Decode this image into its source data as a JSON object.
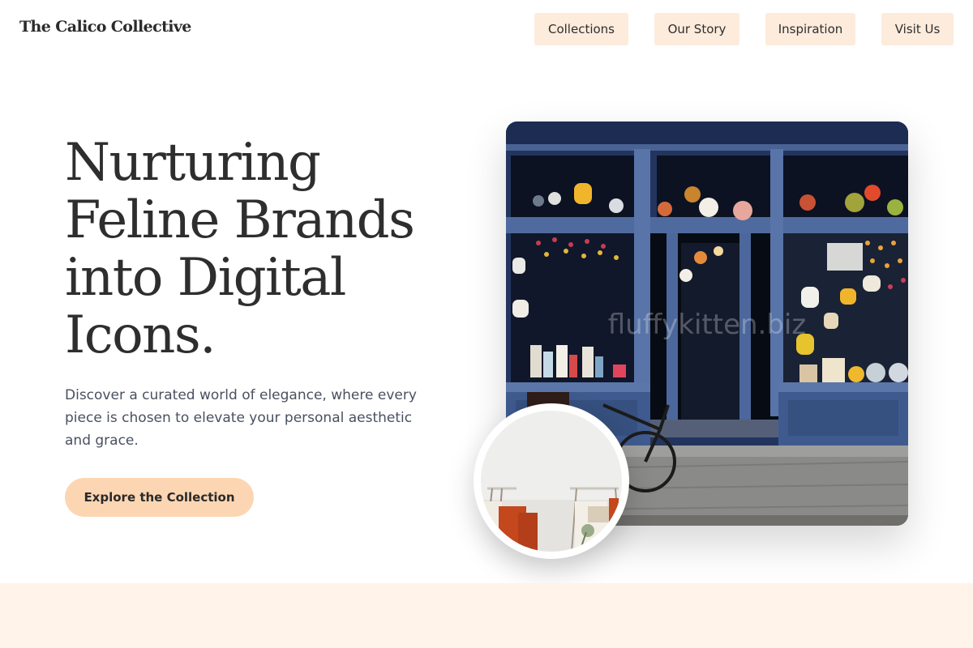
{
  "header": {
    "brand": "The Calico Collective",
    "nav": [
      {
        "label": "Collections"
      },
      {
        "label": "Our Story"
      },
      {
        "label": "Inspiration"
      },
      {
        "label": "Visit Us"
      }
    ]
  },
  "hero": {
    "title": "Nurturing Feline Brands into Digital Icons.",
    "subtitle": "Discover a curated world of elegance, where every piece is chosen to elevate your personal aesthetic and grace.",
    "cta": "Explore the Collection"
  },
  "images": {
    "storefront_watermark": "fluffykitten.biz"
  },
  "colors": {
    "nav_button_bg": "#fdebdc",
    "cta_bg": "#fcd6b3",
    "bottom_band_bg": "#fff3ea",
    "heading_text": "#2e2e2e",
    "body_text": "#4a5060"
  }
}
